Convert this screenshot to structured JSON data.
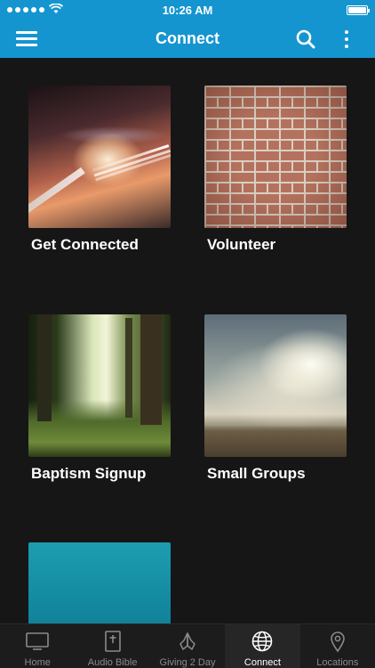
{
  "status_bar": {
    "time": "10:26 AM",
    "signal_icon": "signal-dots-icon",
    "wifi_icon": "wifi-icon",
    "battery_icon": "battery-icon"
  },
  "nav": {
    "title": "Connect",
    "menu_icon": "hamburger-menu-icon",
    "search_icon": "search-icon",
    "more_icon": "more-vertical-icon"
  },
  "tiles": [
    {
      "label": "Get Connected",
      "image": "road-lights-image"
    },
    {
      "label": "Volunteer",
      "image": "brick-wall-image"
    },
    {
      "label": "Baptism Signup",
      "image": "forest-image"
    },
    {
      "label": "Small Groups",
      "image": "clouds-image"
    },
    {
      "label": "",
      "image": "teal-sky-image"
    }
  ],
  "tab_bar": {
    "active": "Connect",
    "tabs": [
      {
        "label": "Home",
        "icon": "tv-icon"
      },
      {
        "label": "Audio Bible",
        "icon": "bible-icon"
      },
      {
        "label": "Giving 2 Day",
        "icon": "praying-hands-icon"
      },
      {
        "label": "Connect",
        "icon": "globe-icon"
      },
      {
        "label": "Locations",
        "icon": "map-pin-icon"
      }
    ]
  },
  "colors": {
    "brand_blue": "#1595cf",
    "background": "#161616",
    "tab_bar": "#1c1c1c",
    "tab_active_text": "#ffffff",
    "tab_inactive_text": "#8a8a8a"
  }
}
